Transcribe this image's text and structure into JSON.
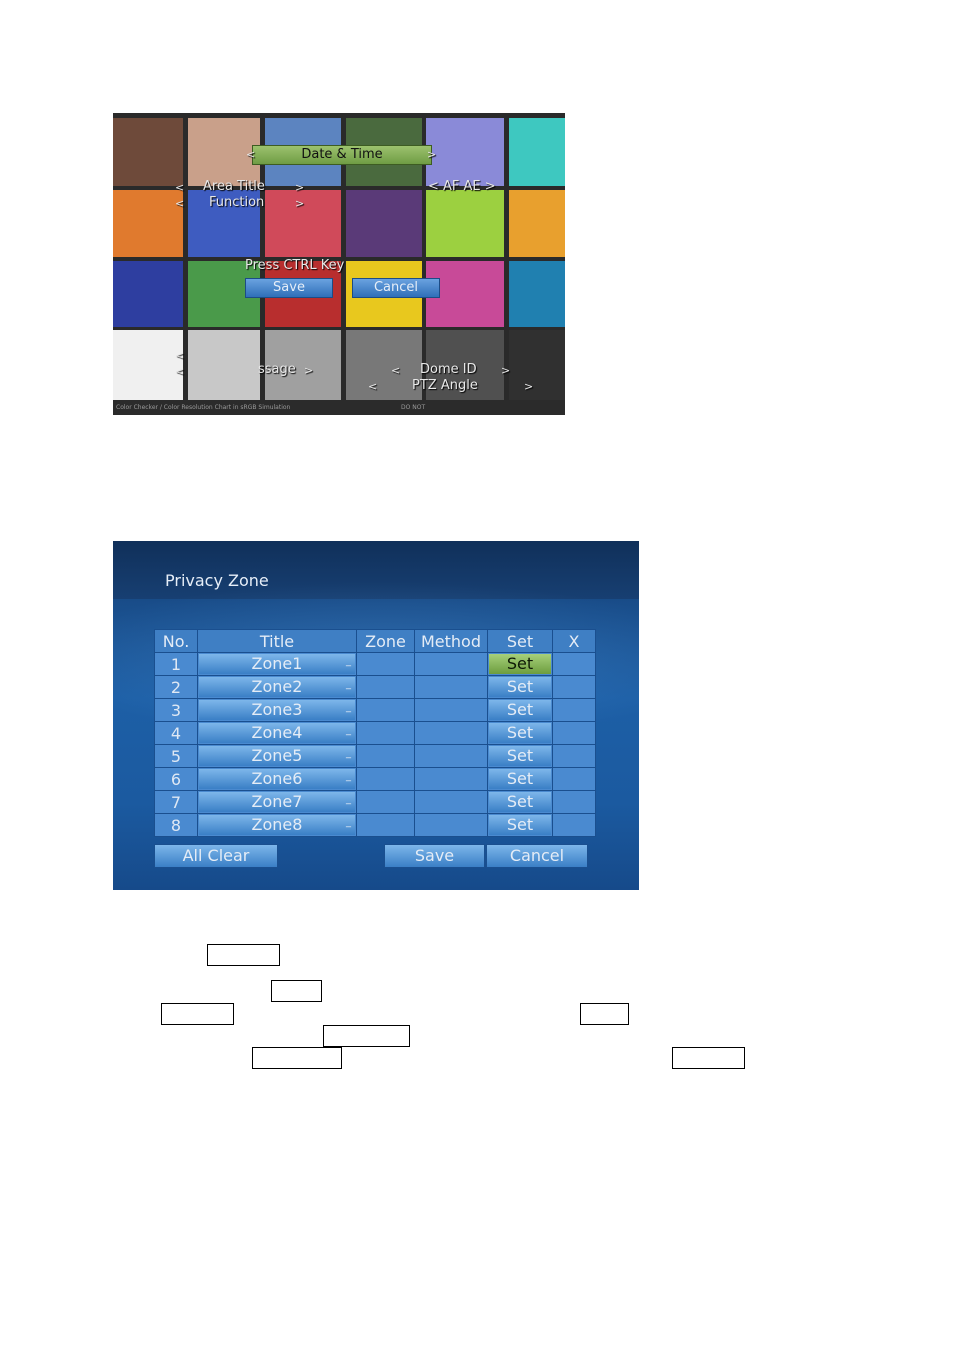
{
  "osd_screen": {
    "title": "Date & Time",
    "left_arrow": "<",
    "right_arrow": ">",
    "menu_items": [
      "Area Title",
      "Function"
    ],
    "af_ae": "< AF AE >",
    "prompt": "Press  CTRL  Key",
    "save_label": "Save",
    "cancel_label": "Cancel",
    "bottom_left_label": "ssage",
    "dome_id": "Dome ID",
    "ptz_angle": "PTZ Angle",
    "caption_left": "Color Checker / Color Resolution Chart in sRGB Simulation",
    "caption_right": "DO NOT",
    "swatch_colors": [
      "#6e4a3a",
      "#c9a08a",
      "#5c84c0",
      "#4a6a3e",
      "#8a8ad8",
      "#3ec8c0",
      "#e07a2e",
      "#3e5cc0",
      "#d04a5a",
      "#5a3a78",
      "#9cd040",
      "#e8a02e",
      "#2e3ea0",
      "#4a9a4a",
      "#b82e2e",
      "#e8c81e",
      "#c84a98",
      "#2080b0",
      "#f0f0f0",
      "#c8c8c8",
      "#a0a0a0",
      "#787878",
      "#505050",
      "#303030"
    ]
  },
  "privacy_zone": {
    "title": "Privacy Zone",
    "headers": [
      "No.",
      "Title",
      "Zone",
      "Method",
      "Set",
      "X"
    ],
    "rows": [
      {
        "no": "1",
        "title": "Zone1",
        "set": "Set"
      },
      {
        "no": "2",
        "title": "Zone2",
        "set": "Set"
      },
      {
        "no": "3",
        "title": "Zone3",
        "set": "Set"
      },
      {
        "no": "4",
        "title": "Zone4",
        "set": "Set"
      },
      {
        "no": "5",
        "title": "Zone5",
        "set": "Set"
      },
      {
        "no": "6",
        "title": "Zone6",
        "set": "Set"
      },
      {
        "no": "7",
        "title": "Zone7",
        "set": "Set"
      },
      {
        "no": "8",
        "title": "Zone8",
        "set": "Set"
      }
    ],
    "cursor_mark": "_",
    "all_clear_label": "All Clear",
    "save_label": "Save",
    "cancel_label": "Cancel"
  }
}
